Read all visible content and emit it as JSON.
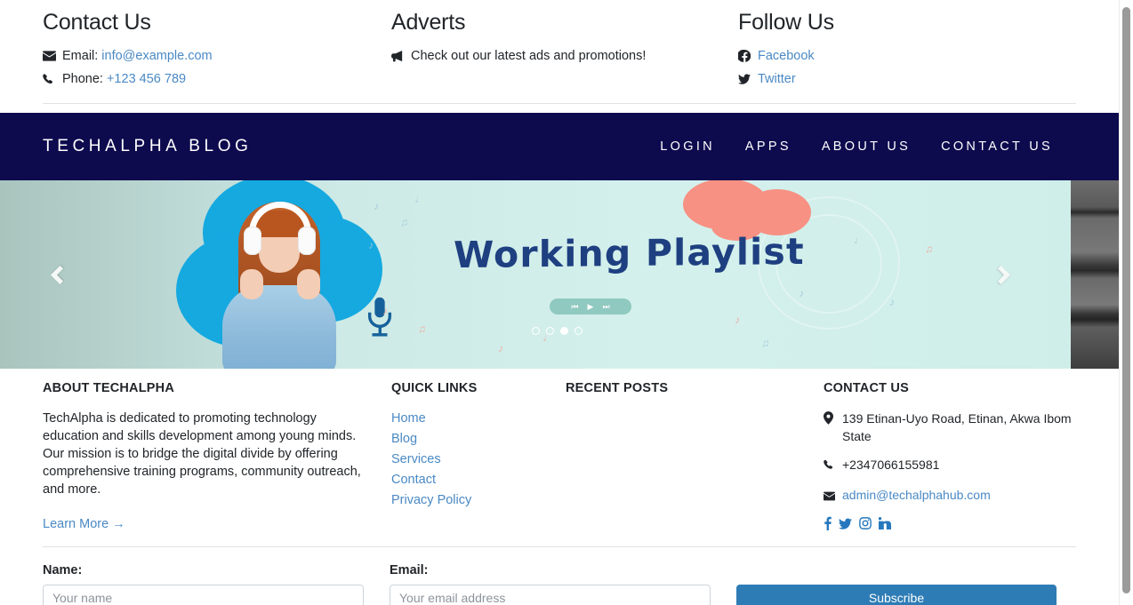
{
  "topbar": {
    "columns": [
      {
        "title": "Contact Us",
        "lines": [
          {
            "icon": "envelope-icon",
            "label": "Email:",
            "link": "info@example.com"
          },
          {
            "icon": "phone-icon",
            "label": "Phone:",
            "link": "+123 456 789"
          }
        ]
      },
      {
        "title": "Adverts",
        "lines": [
          {
            "icon": "bullhorn-icon",
            "label": "Check out our latest ads and promotions!",
            "link": ""
          }
        ]
      },
      {
        "title": "Follow Us",
        "lines": [
          {
            "icon": "facebook-icon",
            "label": "",
            "link": "Facebook"
          },
          {
            "icon": "twitter-icon",
            "label": "",
            "link": "Twitter"
          }
        ]
      }
    ]
  },
  "navbar": {
    "brand": "TECHALPHA BLOG",
    "links": [
      {
        "label": "LOGIN"
      },
      {
        "label": "APPS"
      },
      {
        "label": "ABOUT US"
      },
      {
        "label": "CONTACT US"
      }
    ],
    "background_color": "#0e0a4e"
  },
  "carousel": {
    "slide_title": "Working Playlist",
    "prev_label": "Previous slide",
    "next_label": "Next slide",
    "player": {
      "prev": "⏮",
      "play": "▶",
      "next": "⏭"
    },
    "indicators": [
      {
        "active": false
      },
      {
        "active": false
      },
      {
        "active": true
      },
      {
        "active": false
      }
    ]
  },
  "footer": {
    "about": {
      "heading": "ABOUT TECHALPHA",
      "text": "TechAlpha is dedicated to promoting technology education and skills development among young minds. Our mission is to bridge the digital divide by offering comprehensive training programs, community outreach, and more.",
      "learn_more": "Learn More →"
    },
    "quick_links": {
      "heading": "QUICK LINKS",
      "items": [
        {
          "label": "Home"
        },
        {
          "label": "Blog"
        },
        {
          "label": "Services"
        },
        {
          "label": "Contact"
        },
        {
          "label": "Privacy Policy"
        }
      ]
    },
    "recent_posts": {
      "heading": "RECENT POSTS",
      "items": []
    },
    "contact": {
      "heading": "CONTACT US",
      "address": "139 Etinan-Uyo Road, Etinan, Akwa Ibom State",
      "phone": "+2347066155981",
      "email": "admin@techalphahub.com",
      "socials": [
        {
          "name": "facebook-icon"
        },
        {
          "name": "twitter-icon"
        },
        {
          "name": "instagram-icon"
        },
        {
          "name": "linkedin-icon"
        }
      ]
    }
  },
  "subscribe_form": {
    "name_label": "Name:",
    "name_placeholder": "Your name",
    "name_value": "",
    "email_label": "Email:",
    "email_placeholder": "Your email address",
    "email_value": "",
    "submit_label": "Subscribe",
    "submit_color": "#2e7cb5"
  }
}
